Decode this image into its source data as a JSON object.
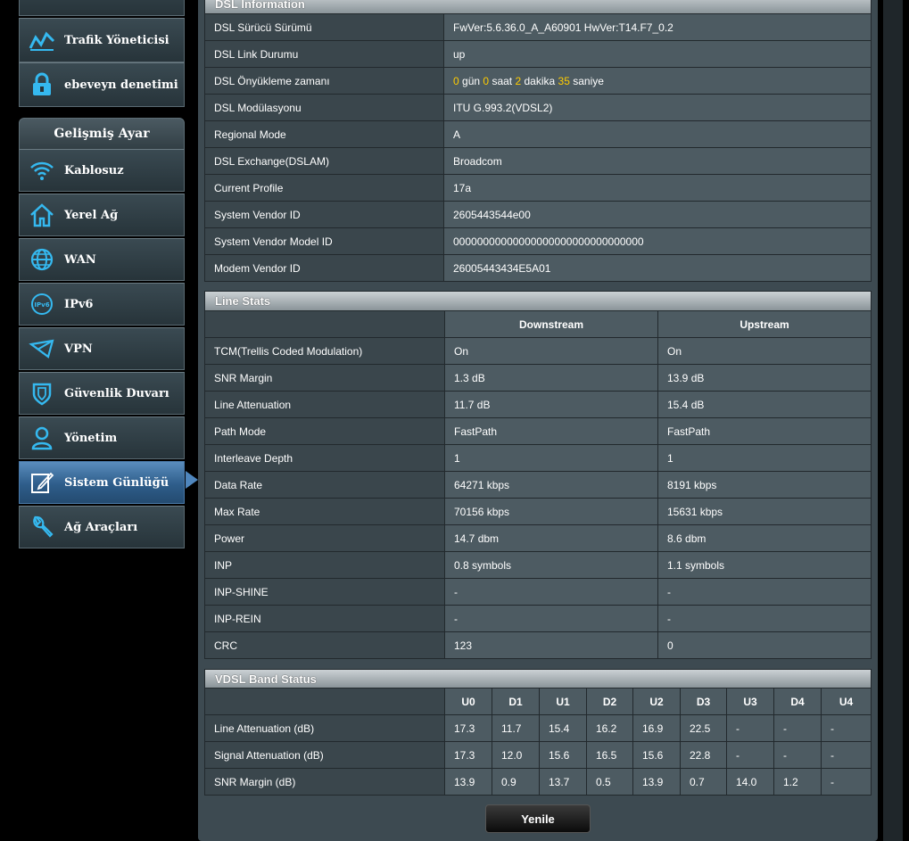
{
  "sidebar": {
    "top_items": [
      {
        "label": "Trafik Yöneticisi",
        "icon": "traffic-icon"
      },
      {
        "label": "ebeveyn denetimi",
        "icon": "lock-icon"
      }
    ],
    "section_title": "Gelişmiş Ayar",
    "items": [
      {
        "label": "Kablosuz",
        "icon": "wifi-icon"
      },
      {
        "label": "Yerel Ağ",
        "icon": "home-icon"
      },
      {
        "label": "WAN",
        "icon": "globe-icon"
      },
      {
        "label": "IPv6",
        "icon": "ipv6-icon"
      },
      {
        "label": "VPN",
        "icon": "vpn-icon"
      },
      {
        "label": "Güvenlik Duvarı",
        "icon": "shield-icon"
      },
      {
        "label": "Yönetim",
        "icon": "user-icon"
      },
      {
        "label": "Sistem Günlüğü",
        "icon": "log-icon",
        "active": true
      },
      {
        "label": "Ağ Araçları",
        "icon": "tools-icon"
      }
    ]
  },
  "dsl_info": {
    "title": "DSL Information",
    "rows": [
      {
        "key": "DSL Sürücü Sürümü",
        "value": "FwVer:5.6.36.0_A_A60901 HwVer:T14.F7_0.2"
      },
      {
        "key": "DSL Link Durumu",
        "value": "up"
      },
      {
        "key": "DSL Önyükleme zamanı",
        "value": ""
      },
      {
        "key": "DSL Modülasyonu",
        "value": "ITU G.993.2(VDSL2)"
      },
      {
        "key": "Regional Mode",
        "value": "A"
      },
      {
        "key": "DSL Exchange(DSLAM)",
        "value": "Broadcom"
      },
      {
        "key": "Current Profile",
        "value": "17a"
      },
      {
        "key": "System Vendor ID",
        "value": "2605443544e00"
      },
      {
        "key": "System Vendor Model ID",
        "value": "00000000000000000000000000000000"
      },
      {
        "key": "Modem Vendor ID",
        "value": "26005443434E5A01"
      }
    ],
    "uptime": {
      "days": "0",
      "days_label": "gün",
      "hours": "0",
      "hours_label": "saat",
      "minutes": "2",
      "minutes_label": "dakika",
      "seconds": "35",
      "seconds_label": "saniye"
    }
  },
  "line_stats": {
    "title": "Line Stats",
    "col_down": "Downstream",
    "col_up": "Upstream",
    "rows": [
      {
        "key": "TCM(Trellis Coded Modulation)",
        "down": "On",
        "up": "On"
      },
      {
        "key": "SNR Margin",
        "down": "1.3 dB",
        "up": "13.9 dB"
      },
      {
        "key": "Line Attenuation",
        "down": "11.7 dB",
        "up": "15.4 dB"
      },
      {
        "key": "Path Mode",
        "down": "FastPath",
        "up": "FastPath"
      },
      {
        "key": "Interleave Depth",
        "down": "1",
        "up": "1"
      },
      {
        "key": "Data Rate",
        "down": "64271 kbps",
        "up": "8191 kbps"
      },
      {
        "key": "Max Rate",
        "down": "70156 kbps",
        "up": "15631 kbps"
      },
      {
        "key": "Power",
        "down": "14.7 dbm",
        "up": "8.6 dbm"
      },
      {
        "key": "INP",
        "down": "0.8 symbols",
        "up": "1.1 symbols"
      },
      {
        "key": "INP-SHINE",
        "down": "-",
        "up": "-"
      },
      {
        "key": "INP-REIN",
        "down": "-",
        "up": "-"
      },
      {
        "key": "CRC",
        "down": "123",
        "up": "0"
      }
    ]
  },
  "vdsl_band": {
    "title": "VDSL Band Status",
    "bands": [
      "U0",
      "D1",
      "U1",
      "D2",
      "U2",
      "D3",
      "U3",
      "D4",
      "U4"
    ],
    "rows": [
      {
        "key": "Line Attenuation (dB)",
        "values": [
          "17.3",
          "11.7",
          "15.4",
          "16.2",
          "16.9",
          "22.5",
          "-",
          "-",
          "-"
        ]
      },
      {
        "key": "Signal Attenuation (dB)",
        "values": [
          "17.3",
          "12.0",
          "15.6",
          "16.5",
          "15.6",
          "22.8",
          "-",
          "-",
          "-"
        ]
      },
      {
        "key": "SNR Margin (dB)",
        "values": [
          "13.9",
          "0.9",
          "13.7",
          "0.5",
          "13.9",
          "0.7",
          "14.0",
          "1.2",
          "-"
        ]
      }
    ]
  },
  "refresh_label": "Yenile",
  "colors": {
    "upstream": "#2fb7f2",
    "downstream": "#ff9a2a",
    "highlight": "#ffcc00",
    "active": "#2e5d8a"
  }
}
